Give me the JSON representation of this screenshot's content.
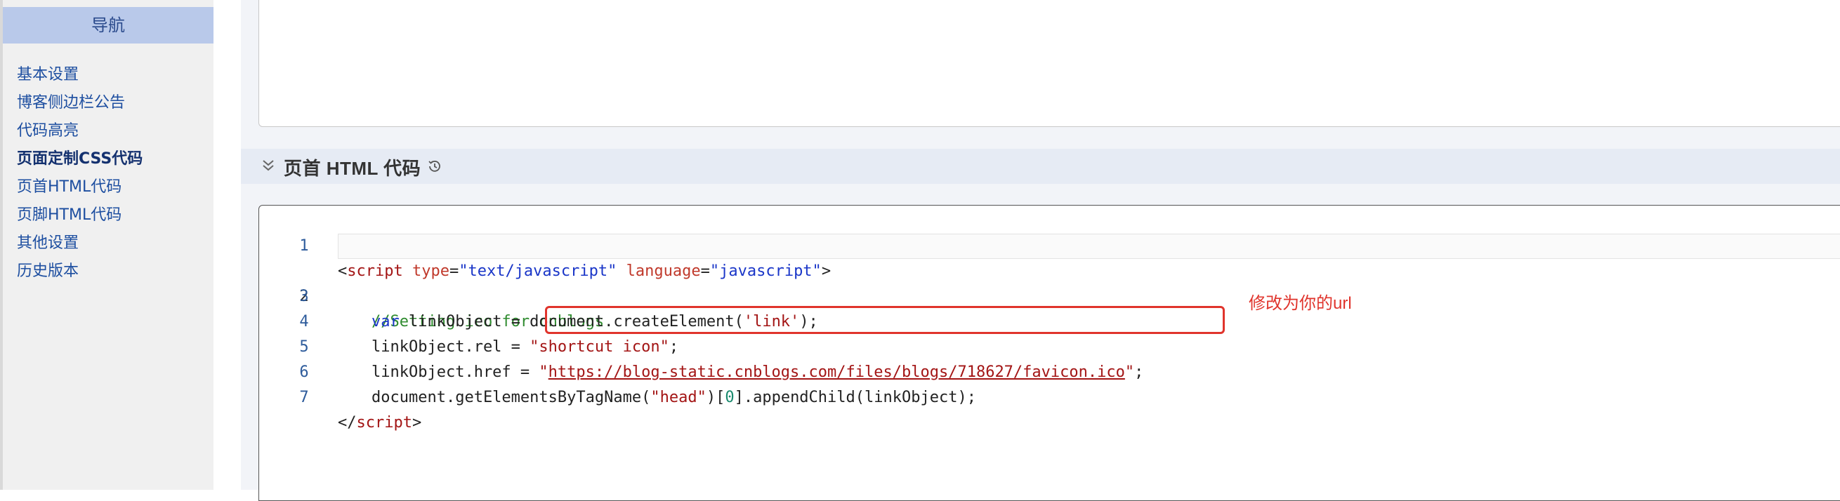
{
  "sidebar": {
    "header": "导航",
    "items": [
      {
        "label": "基本设置",
        "active": false
      },
      {
        "label": "博客侧边栏公告",
        "active": false
      },
      {
        "label": "代码高亮",
        "active": false
      },
      {
        "label": "页面定制CSS代码",
        "active": true
      },
      {
        "label": "页首HTML代码",
        "active": false
      },
      {
        "label": "页脚HTML代码",
        "active": false
      },
      {
        "label": "其他设置",
        "active": false
      },
      {
        "label": "历史版本",
        "active": false
      }
    ]
  },
  "section": {
    "title": "页首 HTML 代码",
    "collapse_icon": "double-chevron-down-icon",
    "history_icon": "history-icon"
  },
  "editor": {
    "current_line": 2,
    "lines": [
      {
        "n": "1"
      },
      {
        "n": "2",
        "text": "//Setting ico for cnblogs"
      },
      {
        "n": "3"
      },
      {
        "n": "4"
      },
      {
        "n": "5"
      },
      {
        "n": "6"
      },
      {
        "n": "7"
      }
    ],
    "tokens": {
      "l1_open": "<",
      "l1_script": "script",
      "l1_type_attr": "type",
      "l1_eq1": "=",
      "l1_type_val": "\"text/javascript\"",
      "l1_lang_attr": "language",
      "l1_eq2": "=",
      "l1_lang_val": "\"javascript\"",
      "l1_close": ">",
      "l3_var": "var",
      "l3_rest": " linkObject = document.createElement(",
      "l3_str": "'link'",
      "l3_end": ");",
      "l4_rest": "linkObject.rel = ",
      "l4_str": "\"shortcut icon\"",
      "l4_end": ";",
      "l5_rest": "linkObject.href = ",
      "l5_q1": "\"",
      "l5_url": "https://blog-static.cnblogs.com/files/blogs/718627/favicon.ico",
      "l5_q2": "\"",
      "l5_end": ";",
      "l6_rest": "document.getElementsByTagName(",
      "l6_str": "\"head\"",
      "l6_mid": ")[",
      "l6_num": "0",
      "l6_end": "].appendChild(linkObject);",
      "l7_open": "</",
      "l7_script": "script",
      "l7_close": ">"
    }
  },
  "annotation": {
    "text": "修改为你的url",
    "color": "#e0342c"
  }
}
